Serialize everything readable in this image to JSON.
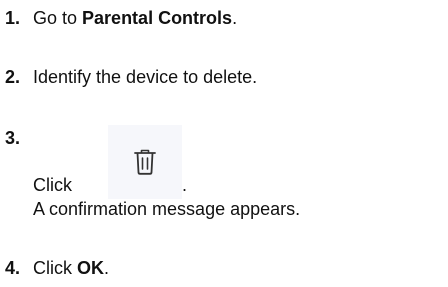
{
  "steps": [
    {
      "number": "1.",
      "prefix": "Go to ",
      "bold": "Parental Controls",
      "suffix": "."
    },
    {
      "number": "2.",
      "text": "Identify the device to delete."
    },
    {
      "number": "3.",
      "click_text": "Click",
      "icon_name": "trash-icon",
      "after_icon": ".",
      "message": "A confirmation message appears."
    },
    {
      "number": "4.",
      "prefix": "Click ",
      "bold": "OK",
      "suffix": "."
    }
  ]
}
